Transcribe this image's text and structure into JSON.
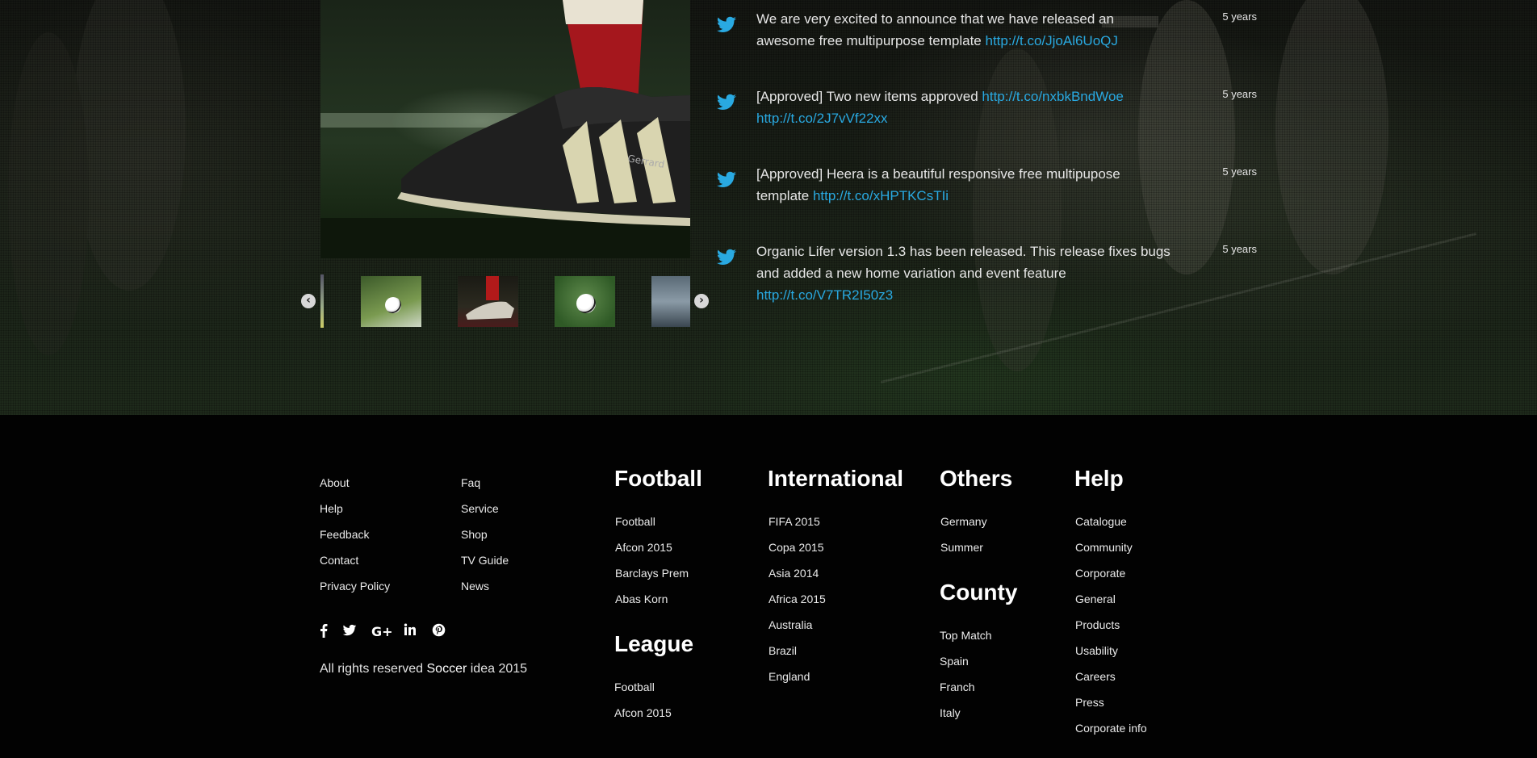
{
  "slider": {
    "prev_label": "‹",
    "next_label": "›",
    "main_image_icon": "soccer-boot-image",
    "thumbnails": [
      "ball-in-net-image",
      "player-boot-image",
      "ball-on-grass-image",
      "player-closeup-image"
    ]
  },
  "tweets": [
    {
      "text": "We are very excited to announce that we have released an awesome free multipurpose template ",
      "link": "http://t.co/JjoAl6UoQJ",
      "time": "5 years"
    },
    {
      "text": "[Approved] Two new items approved ",
      "link": "http://t.co/nxbkBndWoe",
      "link2": "http://t.co/2J7vVf22xx",
      "time": "5 years"
    },
    {
      "text": "[Approved] Heera is a beautiful responsive free multipupose template ",
      "link": "http://t.co/xHPTKCsTIi",
      "time": "5 years"
    },
    {
      "text": "Organic Lifer version 1.3 has been released. This release fixes bugs and added a new home variation and event feature ",
      "link": "http://t.co/V7TR2I50z3",
      "time": "5 years"
    }
  ],
  "footer": {
    "links_col1": [
      "About",
      "Help",
      "Feedback",
      "Contact",
      "Privacy Policy"
    ],
    "links_col2": [
      "Faq",
      "Service",
      "Shop",
      "TV Guide",
      "News"
    ],
    "football": {
      "heading": "Football",
      "items": [
        "Football",
        "Afcon 2015",
        "Barclays Prem",
        "Abas Korn"
      ]
    },
    "league": {
      "heading": "League",
      "items": [
        "Football",
        "Afcon 2015"
      ]
    },
    "international": {
      "heading": "International",
      "items": [
        "FIFA 2015",
        "Copa 2015",
        "Asia 2014",
        "Africa 2015",
        "Australia",
        "Brazil",
        "England"
      ]
    },
    "others": {
      "heading": "Others",
      "items": [
        "Germany",
        "Summer"
      ]
    },
    "county": {
      "heading": "County",
      "items": [
        "Top Match",
        "Spain",
        "Franch",
        "Italy"
      ]
    },
    "help": {
      "heading": "Help",
      "items": [
        "Catalogue",
        "Community",
        "Corporate",
        "General",
        "Products",
        "Usability",
        "Careers",
        "Press",
        "Corporate info"
      ]
    },
    "social": [
      "facebook-icon",
      "twitter-icon",
      "google-plus-icon",
      "linkedin-icon",
      "pinterest-icon"
    ],
    "copyright": {
      "prefix": "All rights reserved ",
      "brand": "Soccer",
      "suffix": " idea 2015"
    }
  },
  "colors": {
    "link_blue": "#29a9e1",
    "twitter_blue": "#29a9e1",
    "footer_bg": "#020202"
  }
}
